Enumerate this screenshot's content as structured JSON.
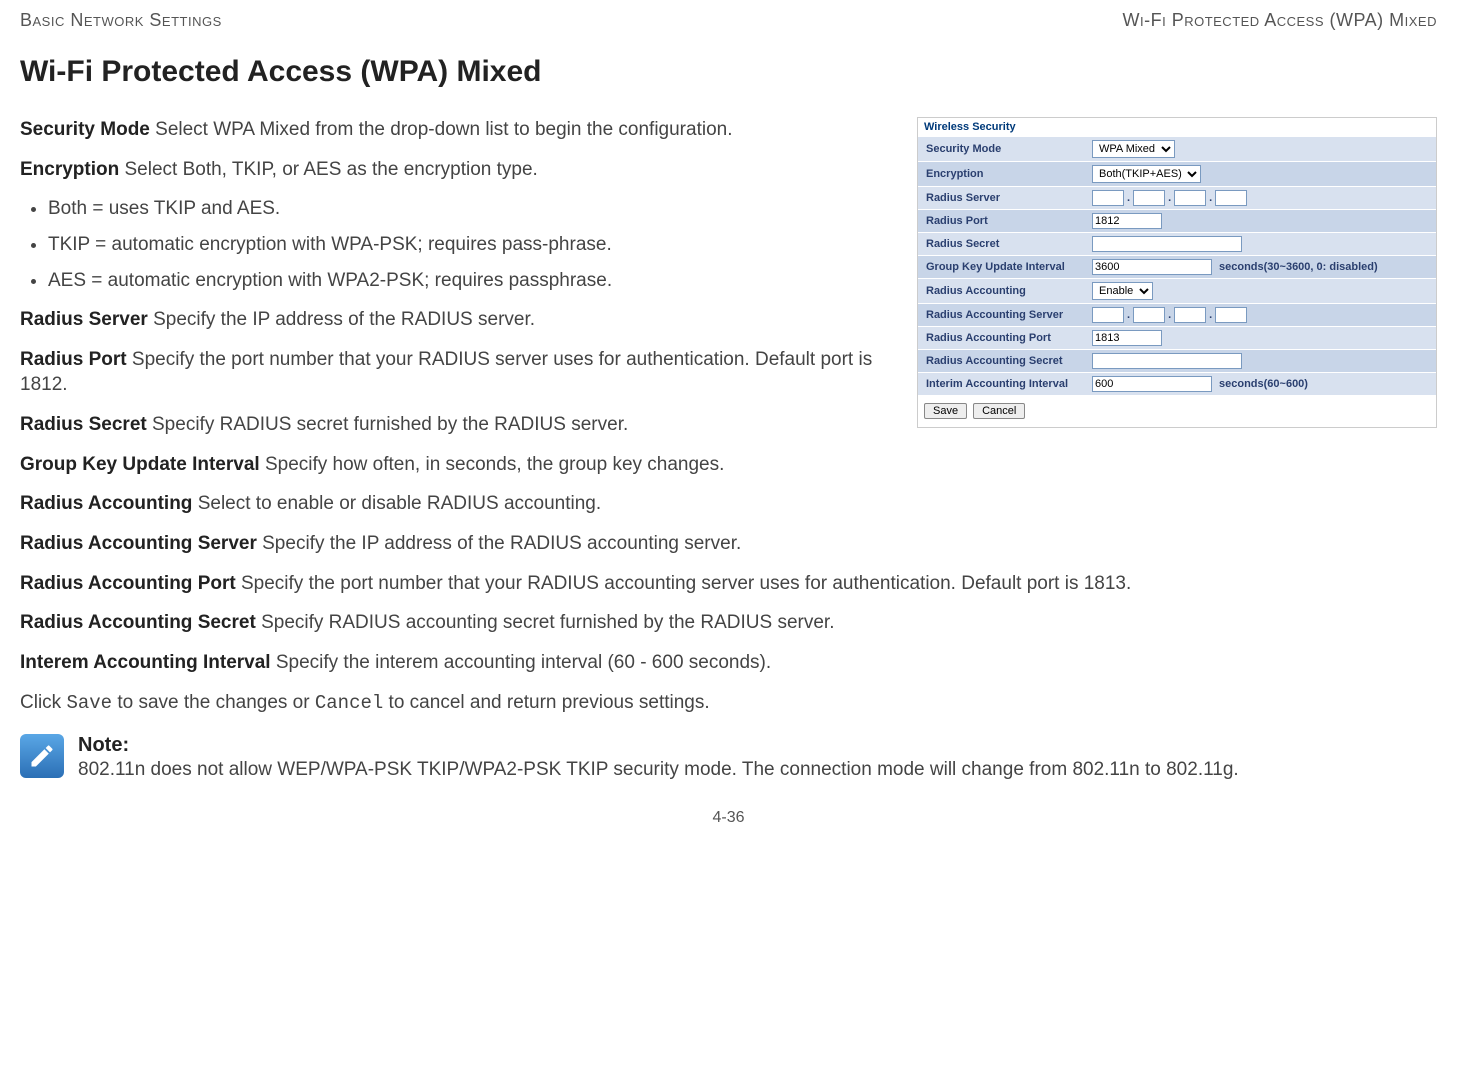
{
  "header": {
    "left": "Basic Network Settings",
    "right": "Wi-Fi Protected Access (WPA) Mixed"
  },
  "title": "Wi-Fi Protected Access (WPA) Mixed",
  "screenshot": {
    "panel_title": "Wireless Security",
    "rows": {
      "security_mode": {
        "label": "Security Mode",
        "value": "WPA Mixed"
      },
      "encryption": {
        "label": "Encryption",
        "value": "Both(TKIP+AES)"
      },
      "radius_server": {
        "label": "Radius Server"
      },
      "radius_port": {
        "label": "Radius Port",
        "value": "1812"
      },
      "radius_secret": {
        "label": "Radius Secret"
      },
      "group_key": {
        "label": "Group Key Update Interval",
        "value": "3600",
        "hint": "seconds(30~3600, 0: disabled)"
      },
      "radius_acct": {
        "label": "Radius Accounting",
        "value": "Enable"
      },
      "radius_acct_server": {
        "label": "Radius Accounting Server"
      },
      "radius_acct_port": {
        "label": "Radius Accounting Port",
        "value": "1813"
      },
      "radius_acct_secret": {
        "label": "Radius Accounting Secret"
      },
      "interim": {
        "label": "Interim Accounting Interval",
        "value": "600",
        "hint": "seconds(60~600)"
      }
    },
    "buttons": {
      "save": "Save",
      "cancel": "Cancel"
    }
  },
  "desc": {
    "security_mode": {
      "label": "Security Mode",
      "text": "  Select WPA Mixed from the drop-down list to begin the configuration."
    },
    "encryption": {
      "label": "Encryption",
      "text": "  Select Both, TKIP, or AES as the encryption type."
    },
    "bullets": {
      "b1": "Both = uses TKIP and AES.",
      "b2": "TKIP = automatic encryption with WPA-PSK; requires pass-phrase.",
      "b3": "AES = automatic encryption with WPA2-PSK; requires passphrase."
    },
    "radius_server": {
      "label": "Radius Server",
      "text": "  Specify the IP address of the RADIUS server."
    },
    "radius_port": {
      "label": "Radius Port",
      "text": "  Specify the port number that your RADIUS server uses for authentication. Default port is 1812."
    },
    "radius_secret": {
      "label": "Radius Secret",
      "text": "  Specify RADIUS secret furnished by the RADIUS server."
    },
    "group_key": {
      "label": "Group Key Update Interval",
      "text": "  Specify how often, in seconds, the group key changes."
    },
    "radius_acct": {
      "label": "Radius Accounting",
      "text": "  Select to enable or disable RADIUS accounting."
    },
    "radius_acct_server": {
      "label": "Radius Accounting Server",
      "text": "  Specify the IP address of the RADIUS accounting server."
    },
    "radius_acct_port": {
      "label": "Radius Accounting Port",
      "text": "  Specify the port number that your RADIUS accounting server uses for authentication. Default port is 1813."
    },
    "radius_acct_secret": {
      "label": "Radius Accounting Secret",
      "text": "  Specify RADIUS accounting secret furnished by the RADIUS server."
    },
    "interim": {
      "label": "Interem Accounting Interval",
      "text": "  Specify the interem accounting interval (60 - 600 seconds)."
    },
    "footer_pre": "Click ",
    "footer_save": "Save",
    "footer_mid": " to save the changes or ",
    "footer_cancel": "Cancel",
    "footer_post": " to cancel and return previous settings."
  },
  "note": {
    "title": "Note:",
    "body": "802.11n does not allow WEP/WPA-PSK TKIP/WPA2-PSK TKIP security mode. The connection mode will change from 802.11n to 802.11g."
  },
  "page_number": "4-36"
}
